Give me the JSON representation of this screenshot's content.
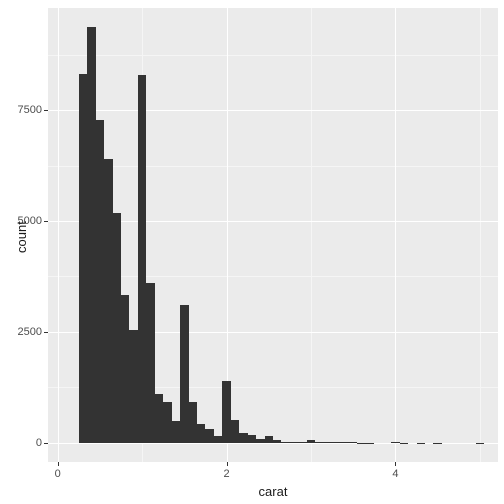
{
  "chart_data": {
    "type": "bar",
    "xlabel": "carat",
    "ylabel": "count",
    "bin_width": 0.1,
    "xlim": [
      0,
      5.1
    ],
    "ylim": [
      0,
      9500
    ],
    "x_ticks": [
      0,
      2,
      4
    ],
    "y_ticks": [
      0,
      2500,
      5000,
      7500
    ],
    "bins": [
      {
        "x": 0.2,
        "count": 0
      },
      {
        "x": 0.3,
        "count": 8310
      },
      {
        "x": 0.4,
        "count": 9370
      },
      {
        "x": 0.5,
        "count": 7280
      },
      {
        "x": 0.6,
        "count": 6400
      },
      {
        "x": 0.7,
        "count": 5170
      },
      {
        "x": 0.8,
        "count": 3330
      },
      {
        "x": 0.9,
        "count": 2550
      },
      {
        "x": 1.0,
        "count": 8280
      },
      {
        "x": 1.1,
        "count": 3610
      },
      {
        "x": 1.2,
        "count": 1100
      },
      {
        "x": 1.3,
        "count": 920
      },
      {
        "x": 1.4,
        "count": 500
      },
      {
        "x": 1.5,
        "count": 3100
      },
      {
        "x": 1.6,
        "count": 930
      },
      {
        "x": 1.7,
        "count": 430
      },
      {
        "x": 1.8,
        "count": 320
      },
      {
        "x": 1.9,
        "count": 150
      },
      {
        "x": 2.0,
        "count": 1400
      },
      {
        "x": 2.1,
        "count": 510
      },
      {
        "x": 2.2,
        "count": 220
      },
      {
        "x": 2.3,
        "count": 180
      },
      {
        "x": 2.4,
        "count": 80
      },
      {
        "x": 2.5,
        "count": 160
      },
      {
        "x": 2.6,
        "count": 60
      },
      {
        "x": 2.7,
        "count": 30
      },
      {
        "x": 2.8,
        "count": 20
      },
      {
        "x": 2.9,
        "count": 10
      },
      {
        "x": 3.0,
        "count": 70
      },
      {
        "x": 3.1,
        "count": 20
      },
      {
        "x": 3.2,
        "count": 10
      },
      {
        "x": 3.3,
        "count": 10
      },
      {
        "x": 3.4,
        "count": 10
      },
      {
        "x": 3.5,
        "count": 10
      },
      {
        "x": 3.6,
        "count": 5
      },
      {
        "x": 3.7,
        "count": 5
      },
      {
        "x": 3.8,
        "count": 0
      },
      {
        "x": 3.9,
        "count": 0
      },
      {
        "x": 4.0,
        "count": 10
      },
      {
        "x": 4.1,
        "count": 5
      },
      {
        "x": 4.2,
        "count": 0
      },
      {
        "x": 4.3,
        "count": 5
      },
      {
        "x": 4.4,
        "count": 0
      },
      {
        "x": 4.5,
        "count": 5
      },
      {
        "x": 4.6,
        "count": 0
      },
      {
        "x": 4.7,
        "count": 0
      },
      {
        "x": 4.8,
        "count": 0
      },
      {
        "x": 4.9,
        "count": 0
      },
      {
        "x": 5.0,
        "count": 5
      }
    ]
  }
}
